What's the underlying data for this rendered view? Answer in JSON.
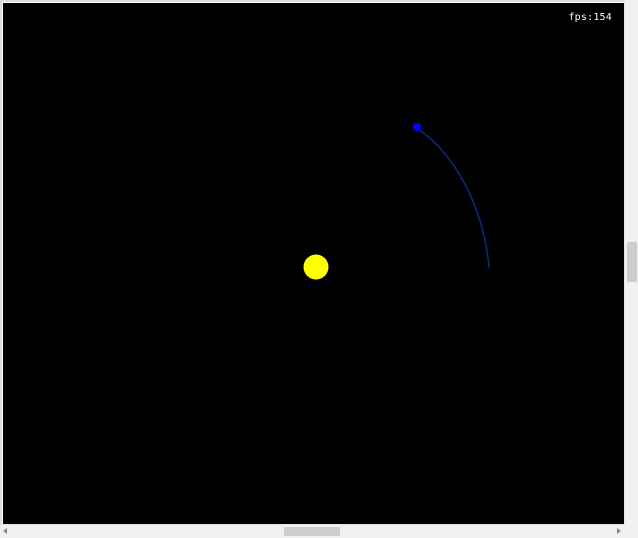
{
  "simulation": {
    "fps_label": "fps:154",
    "background_color": "#000000",
    "sun": {
      "color": "#ffff00"
    },
    "planet": {
      "color": "#0000ff",
      "trail_color": "#0a2a7a"
    }
  },
  "scrollbars": {
    "horizontal": {
      "icon_left": "arrow-left-icon",
      "icon_right": "arrow-right-icon"
    },
    "vertical": {}
  }
}
